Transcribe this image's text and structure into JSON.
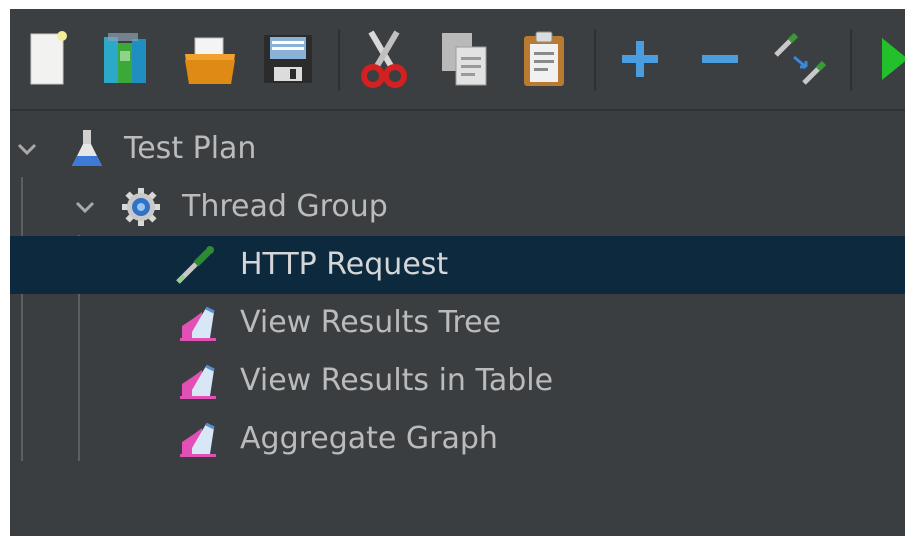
{
  "toolbar": {
    "buttons": [
      {
        "name": "new-button",
        "icon": "new-document-icon"
      },
      {
        "name": "templates-button",
        "icon": "templates-books-icon"
      },
      {
        "name": "open-button",
        "icon": "open-folder-icon"
      },
      {
        "name": "save-button",
        "icon": "floppy-save-icon"
      },
      {
        "name": "cut-button",
        "icon": "scissors-icon"
      },
      {
        "name": "copy-button",
        "icon": "copy-icon"
      },
      {
        "name": "paste-button",
        "icon": "clipboard-paste-icon"
      },
      {
        "name": "expand-all-button",
        "icon": "plus-icon"
      },
      {
        "name": "collapse-all-button",
        "icon": "minus-icon"
      },
      {
        "name": "toggle-button",
        "icon": "pipette-toggle-icon"
      },
      {
        "name": "start-button",
        "icon": "play-icon"
      }
    ]
  },
  "tree": {
    "items": [
      {
        "label": "Test Plan",
        "icon": "flask-icon",
        "expanded": true
      },
      {
        "label": "Thread Group",
        "icon": "gear-icon",
        "expanded": true
      },
      {
        "label": "HTTP Request",
        "icon": "pipette-icon",
        "selected": true
      },
      {
        "label": "View Results Tree",
        "icon": "listener-graph-icon"
      },
      {
        "label": "View Results in Table",
        "icon": "listener-graph-icon"
      },
      {
        "label": "Aggregate Graph",
        "icon": "listener-graph-icon"
      }
    ]
  },
  "colors": {
    "background": "#3b3e40",
    "selection": "#0d293e",
    "text": "#bbbbbb",
    "accent_blue": "#4a9ee0",
    "play_green": "#22c02a"
  }
}
